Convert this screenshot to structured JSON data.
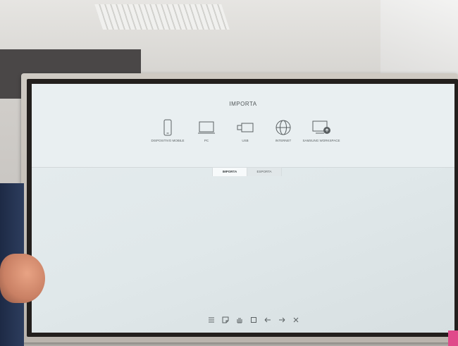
{
  "panel": {
    "title": "IMPORTA",
    "options": [
      {
        "label": "DISPOSITIVO MOBILE",
        "icon": "mobile-icon"
      },
      {
        "label": "PC",
        "icon": "laptop-icon"
      },
      {
        "label": "USB",
        "icon": "usb-icon"
      },
      {
        "label": "INTERNET",
        "icon": "globe-icon"
      },
      {
        "label": "SAMSUNG WORKSPACE",
        "icon": "cloud-monitor-icon"
      }
    ],
    "tabs": [
      {
        "label": "IMPORTA",
        "active": true
      },
      {
        "label": "ESPORTA",
        "active": false
      }
    ]
  },
  "toolbar": {
    "icons": [
      "menu-icon",
      "note-icon",
      "hand-icon",
      "square-icon",
      "undo-icon",
      "redo-icon",
      "close-icon"
    ]
  },
  "colors": {
    "screen": "#e3eaec",
    "bezel": "#c8c2bb",
    "text": "#4f5557"
  }
}
